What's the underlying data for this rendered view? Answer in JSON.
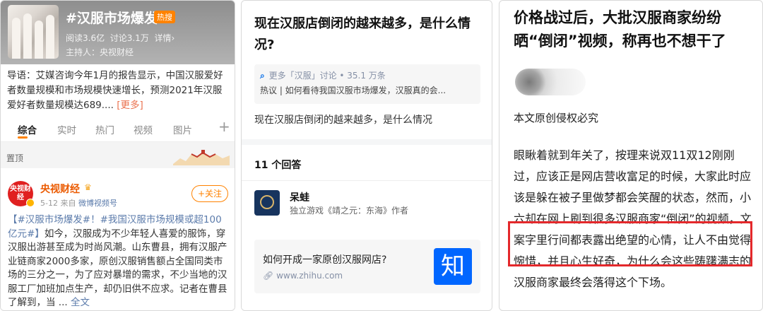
{
  "weibo": {
    "topic": "#汉服市场爆发#",
    "hot_badge": "热搜",
    "reads": "阅读3.6亿",
    "discussions": "讨论3.1万",
    "details": "详情›",
    "host": "主持人：央视财经",
    "intro": "导语：艾媒咨询今年1月的报告显示，中国汉服爱好者数量规模和市场规模快速增长，预测2021年汉服爱好者数量规模达689....",
    "more": "[更多]",
    "tabs": [
      "综合",
      "实时",
      "热门",
      "视频",
      "图片"
    ],
    "plus": "+",
    "pinned": "置顶",
    "post": {
      "avatar_text": "央视财经",
      "author": "央视财经",
      "crown": "♛",
      "date": "5-12",
      "from": "来自",
      "source": "微博视频号",
      "follow": "+关注",
      "text_link": "【#汉服市场爆发#！#我国汉服市场规模或超100亿元#】",
      "text_body": "如今，汉服成为不少年轻人喜爱的服饰，穿汉服出游甚至成为时尚风潮。山东曹县，拥有汉服产业链商家2000多家，原创汉服销售额占全国同类市场的三分之一，为了应对暴增的需求，不少当地的汉服工厂加班加点生产，却仍旧供不应求。记者在曹县了解到，当 ...",
      "full_text": "全文"
    }
  },
  "zhihu": {
    "question": "现在汉服店倒闭的越来越多，是什么情况?",
    "search_icon": "search-icon",
    "more_discussion": "更多「汉服」讨论 • 35.1 万条",
    "hot_line": "热议 | 如何看待我国汉服市场爆发，汉服真的会...",
    "description": "现在汉服店倒闭的越来越多，是什么情况",
    "answers_count": "11 个回答",
    "author": "呆蛙",
    "author_bio": "独立游戏《靖之元：东海》作者",
    "card_title": "如何开成一家原创汉服网店?",
    "card_url": "www.zhihu.com",
    "logo_char": "知"
  },
  "article": {
    "title": "价格战过后，大批汉服商家纷纷晒“倒闭”视频，称再也不想干了",
    "copyright": "本文原创侵权必究",
    "body": "眼瞅着就到年关了，按理来说双11双12刚刚过，应该正是网店营收富足的时候，大家此时应该是躲在被子里做梦都会笑醒的状态，然而，小六却在网上刷到很多汉服商家“倒闭”的视频，文案字里行间都表露出绝望的心情，让人不由觉得惋惜，并且心生好奇，为什么会这些踌躇满志的汉服商家最终会落得这个下场。"
  },
  "colors": {
    "weibo_orange": "#ff8200",
    "zhihu_blue": "#0066ff",
    "highlight_red": "#e4282b"
  }
}
